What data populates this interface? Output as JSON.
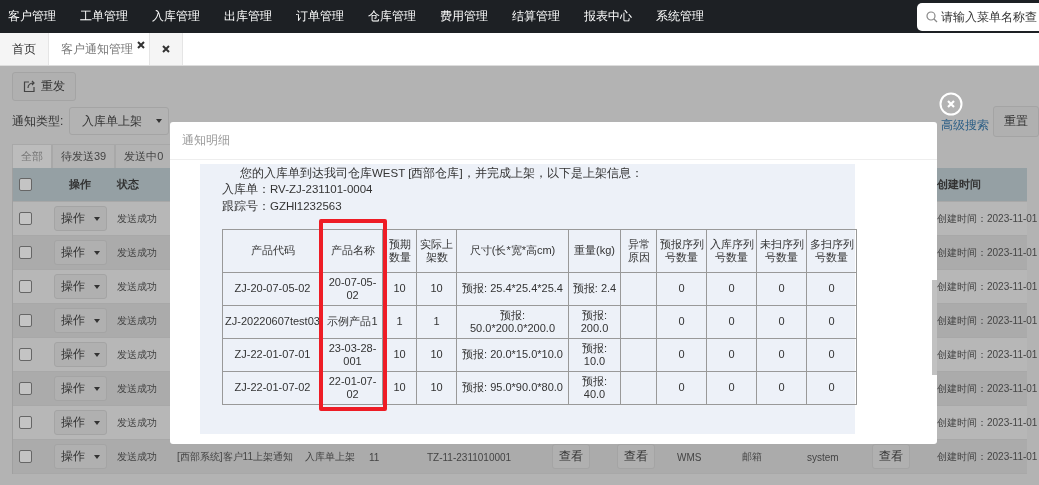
{
  "nav": {
    "items": [
      "客户管理",
      "工单管理",
      "入库管理",
      "出库管理",
      "订单管理",
      "仓库管理",
      "费用管理",
      "结算管理",
      "报表中心",
      "系统管理"
    ],
    "search": {
      "placeholder": "请输入菜单名称查"
    }
  },
  "page_tabs": [
    {
      "label": "首页",
      "selected": false,
      "closable": false
    },
    {
      "label": "客户通知管理",
      "selected": true,
      "closable": true
    },
    {
      "selected": false,
      "closable": true
    }
  ],
  "toolbar": {
    "resend": "重发"
  },
  "filters": {
    "type_label": "通知类型:",
    "type_value": "入库单上架",
    "advanced": "高级搜索",
    "reset": "重置"
  },
  "status_tabs": [
    {
      "label": "全部",
      "selected": true
    },
    {
      "label": "待发送39",
      "selected": false
    },
    {
      "label": "发送中0",
      "selected": false
    }
  ],
  "table": {
    "header": {
      "checked": false,
      "operation": "操作",
      "status": "状态",
      "created": "创建时间"
    },
    "rows": [
      {
        "checked": false,
        "action": "操作",
        "status": "发送成功",
        "created": "创建时间：2023-11-01"
      },
      {
        "checked": false,
        "action": "操作",
        "status": "发送成功",
        "created": "创建时间：2023-11-01"
      },
      {
        "checked": false,
        "action": "操作",
        "status": "发送成功",
        "created": "创建时间：2023-11-01"
      },
      {
        "checked": false,
        "action": "操作",
        "status": "发送成功",
        "created": "创建时间：2023-11-01"
      },
      {
        "checked": false,
        "action": "操作",
        "status": "发送成功",
        "created": "创建时间：2023-11-01"
      },
      {
        "checked": false,
        "action": "操作",
        "status": "发送成功",
        "created": "创建时间：2023-11-01"
      },
      {
        "checked": false,
        "action": "操作",
        "status": "发送成功",
        "created": "创建时间：2023-11-01"
      },
      {
        "checked": false,
        "action": "操作",
        "status": "发送成功",
        "created": "创建时间：2023-11-01",
        "cells": [
          {
            "kind": "text",
            "text": "[西部系统]客户11上架通知"
          },
          {
            "kind": "text",
            "text": "入库单上架"
          },
          {
            "kind": "text",
            "text": "11"
          },
          {
            "kind": "text",
            "text": "TZ-11-2311010001"
          },
          {
            "kind": "button",
            "text": "查看"
          },
          {
            "kind": "button",
            "text": "查看"
          },
          {
            "kind": "text",
            "text": "WMS"
          },
          {
            "kind": "text",
            "text": "邮箱"
          },
          {
            "kind": "text",
            "text": "system"
          },
          {
            "kind": "button",
            "text": "查看"
          }
        ]
      }
    ]
  },
  "modal": {
    "title": "通知明细",
    "message": "您的入库单到达我司仓库WEST [西部仓库]，并完成上架，以下是上架信息：",
    "inbound": "入库单：RV-ZJ-231101-0004",
    "tracking": "跟踪号：GZHl1232563",
    "columns": [
      "产品代码",
      "产品名称",
      "预期数量",
      "实际上架数",
      "尺寸(长*宽*高cm)",
      "重量(kg)",
      "异常原因",
      "预报序列号数量",
      "入库序列号数量",
      "未扫序列号数量",
      "多扫序列号数量"
    ],
    "rows": [
      [
        "ZJ-20-07-05-02",
        "20-07-05-02",
        "10",
        "10",
        "预报: 25.4*25.4*25.4",
        "预报: 2.4",
        "",
        "0",
        "0",
        "0",
        "0"
      ],
      [
        "ZJ-20220607test03",
        "示例产品1",
        "1",
        "1",
        "预报: 50.0*200.0*200.0",
        "预报: 200.0",
        "",
        "0",
        "0",
        "0",
        "0"
      ],
      [
        "ZJ-22-01-07-01",
        "23-03-28-001",
        "10",
        "10",
        "预报: 20.0*15.0*10.0",
        "预报: 10.0",
        "",
        "0",
        "0",
        "0",
        "0"
      ],
      [
        "ZJ-22-01-07-02",
        "22-01-07-02",
        "10",
        "10",
        "预报: 95.0*90.0*80.0",
        "预报: 40.0",
        "",
        "0",
        "0",
        "0",
        "0"
      ]
    ]
  }
}
